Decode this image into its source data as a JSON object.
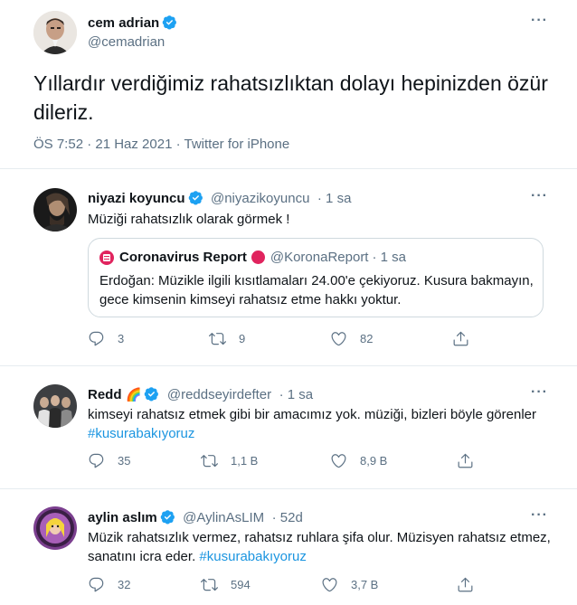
{
  "main_tweet": {
    "name": "cem adrian",
    "handle": "@cemadrian",
    "text": "Yıllardır verdiğimiz rahatsızlıktan dolayı hepinizden özür dileriz.",
    "timestamp": "ÖS 7:52 · 21 Haz 2021 · Twitter for iPhone"
  },
  "reply1": {
    "name": "niyazi koyuncu",
    "handle": "@niyazikoyuncu",
    "time": "· 1 sa",
    "text": "Müziği rahatsızlık olarak görmek !",
    "quote": {
      "name": "Coronavirus Report",
      "handle": "@KoronaReport",
      "time": "· 1 sa",
      "text": "Erdoğan: Müzikle ilgili kısıtlamaları 24.00'e çekiyoruz. Kusura bakmayın, gece kimsenin kimseyi rahatsız etme hakkı yoktur."
    },
    "replies": "3",
    "retweets": "9",
    "likes": "82"
  },
  "reply2": {
    "name": "Redd",
    "emoji": "🌈",
    "handle": "@reddseyirdefter",
    "time": "· 1 sa",
    "text": "kimseyi rahatsız etmek gibi bir amacımız yok. müziği, bizleri böyle görenler",
    "hashtag": "#kusurabakıyoruz",
    "replies": "35",
    "retweets": "1,1 B",
    "likes": "8,9 B"
  },
  "reply3": {
    "name": "aylin aslım",
    "handle": "@AylinAsLIM",
    "time": "· 52d",
    "text_line1": "Müzik rahatsızlık vermez, rahatsız ruhlara şifa olur. Müzisyen rahatsız etmez,",
    "text_line2": "sanatını icra eder.",
    "hashtag": "#kusurabakıyoruz",
    "replies": "32",
    "retweets": "594",
    "likes": "3,7 B"
  },
  "colors": {
    "accent": "#1b95e0",
    "verified": "#1da1f2",
    "secondary_text": "#5b7083",
    "divider": "#e6ecf0",
    "live_dot": "#e0245e"
  }
}
